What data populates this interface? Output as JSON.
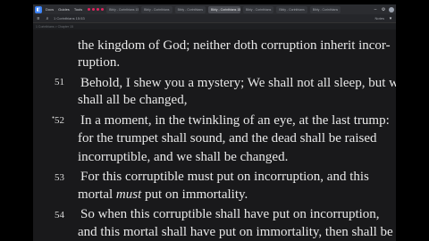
{
  "window": {
    "menu": [
      "Docs",
      "Guides",
      "Tools"
    ],
    "tabs": [
      {
        "label": "Bibly - Corinthians 15"
      },
      {
        "label": "Bibly - Corinthians"
      },
      {
        "label": "Bibly - Corinthians"
      },
      {
        "label": "Bibly - Corinthians 15",
        "active": true
      },
      {
        "label": "Bibly - Corinthians"
      },
      {
        "label": "Bibly - Corinthians"
      },
      {
        "label": "Bibly - Corinthians"
      }
    ],
    "address": "1 Corinthians 15:53",
    "breadcrumb": "1 Corinthians > Chapter 15",
    "right_label": "Notes"
  },
  "passage": {
    "partial_line_1": "the kingdom of God; neither doth corruption inherit incor-",
    "partial_line_2": "ruption.",
    "verses": [
      {
        "number": "51",
        "lines": [
          "Behold, I shew you a mystery; We shall not all sleep, but we",
          "shall all be changed,"
        ]
      },
      {
        "number": "52",
        "lines": [
          "In a moment, in the twinkling of an eye, at the last trump:",
          "for the trumpet shall sound, and the dead shall be raised",
          "incorruptible, and we shall be changed."
        ]
      },
      {
        "number": "53",
        "lines": [
          "For this corruptible must put on incorruption, and this",
          "mortal",
          "must",
          "put on immortality."
        ]
      },
      {
        "number": "54",
        "lines": [
          "So when this corruptible shall have put on incorruption,",
          "and this mortal shall have put on immortality, then shall be"
        ]
      }
    ]
  },
  "colors": {
    "accent": "#3b82f6",
    "dots": "#e0245e",
    "page_background": "#19191b",
    "text": "#e8e8e8"
  }
}
